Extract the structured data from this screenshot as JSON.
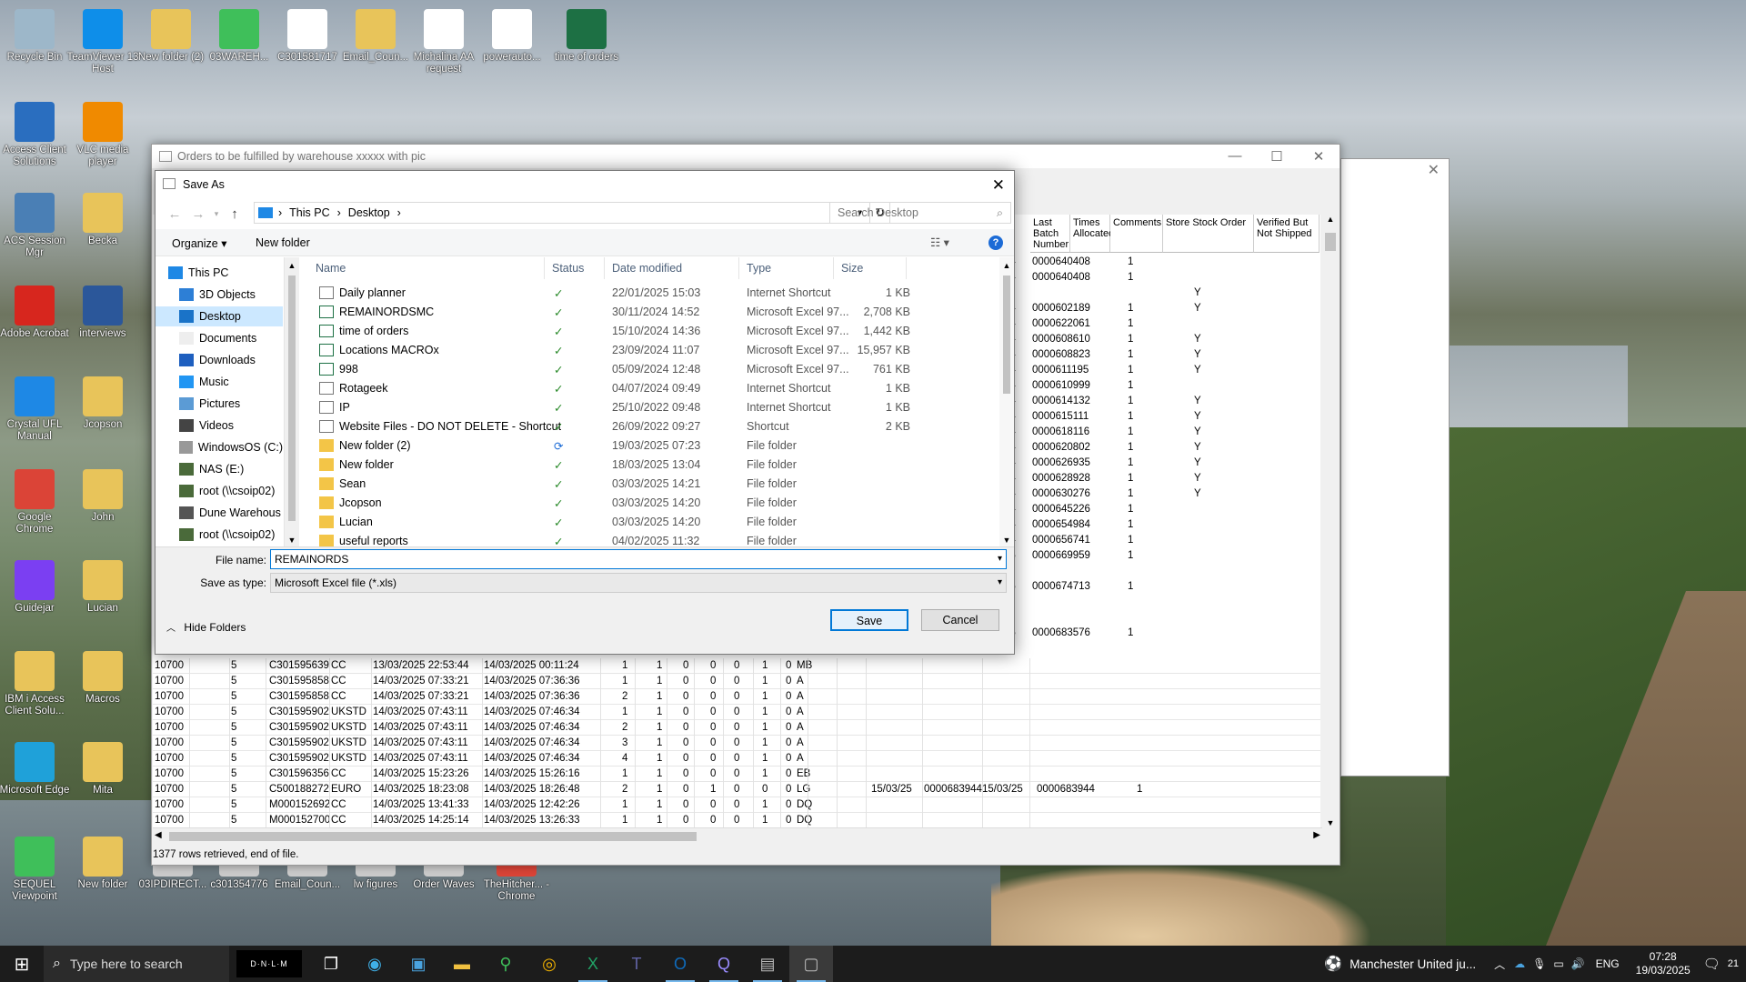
{
  "desktop_icons": [
    {
      "label": "Recycle Bin",
      "icon": "recycle-bin-icon",
      "color": "#9db7c9"
    },
    {
      "label": "TeamViewer 13 Host",
      "icon": "teamviewer-icon",
      "color": "#0e8ee9"
    },
    {
      "label": "New folder (2)",
      "icon": "folder-icon",
      "color": "#e8c45a"
    },
    {
      "label": "03WAREH...",
      "icon": "sequel-viewpoint-icon",
      "color": "#3fbf5a"
    },
    {
      "label": "C301581717",
      "icon": "pdf-file-icon",
      "color": "#ffffff"
    },
    {
      "label": "Email_Coun...",
      "icon": "zip-folder-icon",
      "color": "#e8c45a"
    },
    {
      "label": "Michalina AA request",
      "icon": "pdf-file-icon",
      "color": "#ffffff"
    },
    {
      "label": "powerauto...",
      "icon": "document-icon",
      "color": "#ffffff"
    },
    {
      "label": "time of orders",
      "icon": "excel-file-icon",
      "color": "#1d7044"
    },
    {
      "label": "Access Client Solutions",
      "icon": "ibm-access-icon",
      "color": "#2a6ebf"
    },
    {
      "label": "VLC media player",
      "icon": "vlc-icon",
      "color": "#f08a00"
    },
    {
      "label": "ACS Session Mgr",
      "icon": "acs-session-icon",
      "color": "#4a7fb5"
    },
    {
      "label": "Becka",
      "icon": "folder-icon",
      "color": "#e8c45a"
    },
    {
      "label": "Adobe Acrobat",
      "icon": "acrobat-icon",
      "color": "#d7261e"
    },
    {
      "label": "interviews",
      "icon": "word-file-icon",
      "color": "#2b579a"
    },
    {
      "label": "Crystal UFL Manual",
      "icon": "ie-icon",
      "color": "#1e88e5"
    },
    {
      "label": "Jcopson",
      "icon": "chrome-folder-icon",
      "color": "#e8c45a"
    },
    {
      "label": "Google Chrome",
      "icon": "chrome-icon",
      "color": "#db4437"
    },
    {
      "label": "John",
      "icon": "pdf-folder-icon",
      "color": "#e8c45a"
    },
    {
      "label": "Guidejar",
      "icon": "guidejar-icon",
      "color": "#7b3ff2"
    },
    {
      "label": "Lucian",
      "icon": "chrome-folder-icon",
      "color": "#e8c45a"
    },
    {
      "label": "IBM i Access Client Solu...",
      "icon": "folder-icon",
      "color": "#e8c45a"
    },
    {
      "label": "Macros",
      "icon": "excel-folder-icon",
      "color": "#e8c45a"
    },
    {
      "label": "Microsoft Edge",
      "icon": "edge-icon",
      "color": "#1fa1d9"
    },
    {
      "label": "Mita",
      "icon": "chrome-folder-icon",
      "color": "#e8c45a"
    },
    {
      "label": "SEQUEL Viewpoint",
      "icon": "sequel-viewpoint-icon",
      "color": "#3fbf5a"
    },
    {
      "label": "New folder",
      "icon": "image-folder-icon",
      "color": "#e8c45a"
    },
    {
      "label": "03IPDIRECT...",
      "icon": "app-icon",
      "color": "#cccccc"
    },
    {
      "label": "c301354776",
      "icon": "app-icon",
      "color": "#cccccc"
    },
    {
      "label": "Email_Coun...",
      "icon": "app-icon",
      "color": "#cccccc"
    },
    {
      "label": "lw figures",
      "icon": "app-icon",
      "color": "#cccccc"
    },
    {
      "label": "Order Waves",
      "icon": "app-icon",
      "color": "#cccccc"
    },
    {
      "label": "TheHitcher... - Chrome",
      "icon": "chrome-icon",
      "color": "#db4437"
    }
  ],
  "bg_window": {
    "title": "Orders to be fulfilled by warehouse xxxxx with pic",
    "headers": [
      "Last Batch Number",
      "Times Allocated",
      "Comments",
      "Store Stock Order",
      "Verified But Not Shipped"
    ],
    "right_rows": [
      {
        "prefix": "24",
        "batch": "0000640408",
        "times": "1",
        "store": ""
      },
      {
        "prefix": "24",
        "batch": "0000640408",
        "times": "1",
        "store": ""
      },
      {
        "prefix": "",
        "batch": "",
        "times": "",
        "store": "Y"
      },
      {
        "prefix": "24",
        "batch": "0000602189",
        "times": "1",
        "store": "Y"
      },
      {
        "prefix": "24",
        "batch": "0000622061",
        "times": "1",
        "store": ""
      },
      {
        "prefix": "24",
        "batch": "0000608610",
        "times": "1",
        "store": "Y"
      },
      {
        "prefix": "24",
        "batch": "0000608823",
        "times": "1",
        "store": "Y"
      },
      {
        "prefix": "24",
        "batch": "0000611195",
        "times": "1",
        "store": "Y"
      },
      {
        "prefix": "24",
        "batch": "0000610999",
        "times": "1",
        "store": ""
      },
      {
        "prefix": "24",
        "batch": "0000614132",
        "times": "1",
        "store": "Y"
      },
      {
        "prefix": "24",
        "batch": "0000615111",
        "times": "1",
        "store": "Y"
      },
      {
        "prefix": "24",
        "batch": "0000618116",
        "times": "1",
        "store": "Y"
      },
      {
        "prefix": "24",
        "batch": "0000620802",
        "times": "1",
        "store": "Y"
      },
      {
        "prefix": "24",
        "batch": "0000626935",
        "times": "1",
        "store": "Y"
      },
      {
        "prefix": "24",
        "batch": "0000628928",
        "times": "1",
        "store": "Y"
      },
      {
        "prefix": "24",
        "batch": "0000630276",
        "times": "1",
        "store": "Y"
      },
      {
        "prefix": "24",
        "batch": "0000645226",
        "times": "1",
        "store": ""
      },
      {
        "prefix": "24",
        "batch": "0000654984",
        "times": "1",
        "store": ""
      },
      {
        "prefix": "24",
        "batch": "0000656741",
        "times": "1",
        "store": ""
      },
      {
        "prefix": "25",
        "batch": "0000669959",
        "times": "1",
        "store": ""
      },
      {
        "prefix": "",
        "batch": "",
        "times": "",
        "store": ""
      },
      {
        "prefix": "25",
        "batch": "0000674713",
        "times": "1",
        "store": ""
      },
      {
        "prefix": "",
        "batch": "",
        "times": "",
        "store": ""
      },
      {
        "prefix": "",
        "batch": "",
        "times": "",
        "store": ""
      },
      {
        "prefix": "25",
        "batch": "0000683576",
        "times": "1",
        "store": ""
      }
    ],
    "rows": [
      [
        "10700",
        "5",
        "C301595639",
        "CC",
        "13/03/2025 22:53:44",
        "14/03/2025 00:11:24",
        "1",
        "1",
        "0",
        "0",
        "0",
        "1",
        "0",
        "MB",
        "",
        "",
        "",
        ""
      ],
      [
        "10700",
        "5",
        "C301595858",
        "CC",
        "14/03/2025 07:33:21",
        "14/03/2025 07:36:36",
        "1",
        "1",
        "0",
        "0",
        "0",
        "1",
        "0",
        "A",
        "",
        "",
        "",
        ""
      ],
      [
        "10700",
        "5",
        "C301595858",
        "CC",
        "14/03/2025 07:33:21",
        "14/03/2025 07:36:36",
        "2",
        "1",
        "0",
        "0",
        "0",
        "1",
        "0",
        "A",
        "",
        "",
        "",
        ""
      ],
      [
        "10700",
        "5",
        "C301595902",
        "UKSTD",
        "14/03/2025 07:43:11",
        "14/03/2025 07:46:34",
        "1",
        "1",
        "0",
        "0",
        "0",
        "1",
        "0",
        "A",
        "",
        "",
        "",
        ""
      ],
      [
        "10700",
        "5",
        "C301595902",
        "UKSTD",
        "14/03/2025 07:43:11",
        "14/03/2025 07:46:34",
        "2",
        "1",
        "0",
        "0",
        "0",
        "1",
        "0",
        "A",
        "",
        "",
        "",
        ""
      ],
      [
        "10700",
        "5",
        "C301595902",
        "UKSTD",
        "14/03/2025 07:43:11",
        "14/03/2025 07:46:34",
        "3",
        "1",
        "0",
        "0",
        "0",
        "1",
        "0",
        "A",
        "",
        "",
        "",
        ""
      ],
      [
        "10700",
        "5",
        "C301595902",
        "UKSTD",
        "14/03/2025 07:43:11",
        "14/03/2025 07:46:34",
        "4",
        "1",
        "0",
        "0",
        "0",
        "1",
        "0",
        "A",
        "",
        "",
        "",
        ""
      ],
      [
        "10700",
        "5",
        "C301596356",
        "CC",
        "14/03/2025 15:23:26",
        "14/03/2025 15:26:16",
        "1",
        "1",
        "0",
        "0",
        "0",
        "1",
        "0",
        "EB",
        "",
        "",
        "",
        ""
      ],
      [
        "10700",
        "5",
        "C500188272",
        "EURO",
        "14/03/2025 18:23:08",
        "14/03/2025 18:26:48",
        "2",
        "1",
        "0",
        "1",
        "0",
        "0",
        "0",
        "LG",
        "15/03/25",
        "0000683944",
        "15/03/25",
        "0000683944",
        "1"
      ],
      [
        "10700",
        "5",
        "M000152692",
        "CC",
        "14/03/2025 13:41:33",
        "14/03/2025 12:42:26",
        "1",
        "1",
        "0",
        "0",
        "0",
        "1",
        "0",
        "DQ",
        "",
        "",
        "",
        ""
      ],
      [
        "10700",
        "5",
        "M000152700",
        "CC",
        "14/03/2025 14:25:14",
        "14/03/2025 13:26:33",
        "1",
        "1",
        "0",
        "0",
        "0",
        "1",
        "0",
        "DQ",
        "",
        "",
        "",
        ""
      ]
    ],
    "status": "1377 rows retrieved, end of file."
  },
  "dialog": {
    "title": "Save As",
    "path": [
      "This PC",
      "Desktop"
    ],
    "search_placeholder": "Search Desktop",
    "organize": "Organize ▾",
    "new_folder": "New folder",
    "tree": [
      "This PC",
      "3D Objects",
      "Desktop",
      "Documents",
      "Downloads",
      "Music",
      "Pictures",
      "Videos",
      "WindowsOS (C:)",
      "NAS (E:)",
      "root (\\\\csoip02)",
      "Dune Warehous",
      "root (\\\\csoip02)"
    ],
    "columns": [
      "Name",
      "Status",
      "Date modified",
      "Type",
      "Size"
    ],
    "files": [
      {
        "name": "Daily planner",
        "date": "22/01/2025 15:03",
        "type": "Internet Shortcut",
        "size": "1 KB",
        "kind": "shortcut"
      },
      {
        "name": "REMAINORDSMC",
        "date": "30/11/2024 14:52",
        "type": "Microsoft Excel 97...",
        "size": "2,708 KB",
        "kind": "excel"
      },
      {
        "name": "time of orders",
        "date": "15/10/2024 14:36",
        "type": "Microsoft Excel 97...",
        "size": "1,442 KB",
        "kind": "excel"
      },
      {
        "name": "Locations MACROx",
        "date": "23/09/2024 11:07",
        "type": "Microsoft Excel 97...",
        "size": "15,957 KB",
        "kind": "excel"
      },
      {
        "name": "998",
        "date": "05/09/2024 12:48",
        "type": "Microsoft Excel 97...",
        "size": "761 KB",
        "kind": "excel"
      },
      {
        "name": "Rotageek",
        "date": "04/07/2024 09:49",
        "type": "Internet Shortcut",
        "size": "1 KB",
        "kind": "shortcut"
      },
      {
        "name": "IP",
        "date": "25/10/2022 09:48",
        "type": "Internet Shortcut",
        "size": "1 KB",
        "kind": "shortcut"
      },
      {
        "name": "Website Files - DO NOT DELETE - Shortcut",
        "date": "26/09/2022 09:27",
        "type": "Shortcut",
        "size": "2 KB",
        "kind": "shortcut"
      },
      {
        "name": "New folder (2)",
        "date": "19/03/2025 07:23",
        "type": "File folder",
        "size": "",
        "kind": "folder",
        "sync": true
      },
      {
        "name": "New folder",
        "date": "18/03/2025 13:04",
        "type": "File folder",
        "size": "",
        "kind": "folder"
      },
      {
        "name": "Sean",
        "date": "03/03/2025 14:21",
        "type": "File folder",
        "size": "",
        "kind": "folder"
      },
      {
        "name": "Jcopson",
        "date": "03/03/2025 14:20",
        "type": "File folder",
        "size": "",
        "kind": "folder"
      },
      {
        "name": "Lucian",
        "date": "03/03/2025 14:20",
        "type": "File folder",
        "size": "",
        "kind": "folder"
      },
      {
        "name": "useful reports",
        "date": "04/02/2025 11:32",
        "type": "File folder",
        "size": "",
        "kind": "folder"
      }
    ],
    "file_name_label": "File name:",
    "file_name": "REMAINORDS",
    "save_type_label": "Save as type:",
    "save_type": "Microsoft Excel file (*.xls)",
    "hide_folders": "Hide Folders",
    "save": "Save",
    "cancel": "Cancel"
  },
  "taskbar": {
    "search_placeholder": "Type here to search",
    "weather": "Manchester United ju...",
    "lang": "ENG",
    "time": "07:28",
    "date": "19/03/2025",
    "notif_count": "21"
  }
}
